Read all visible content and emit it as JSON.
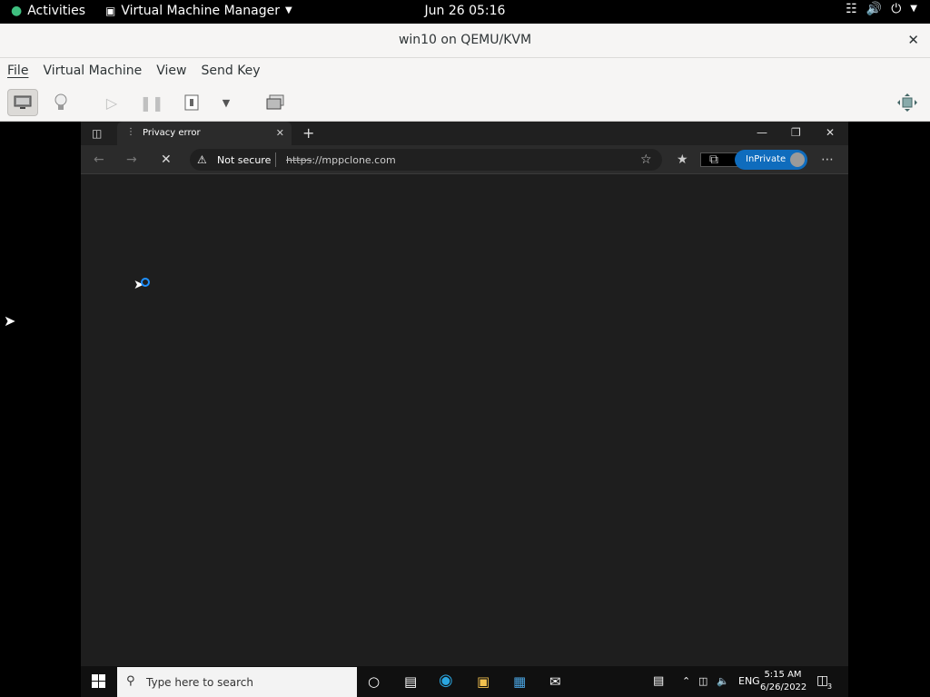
{
  "top_bar": {
    "activities_label": "Activities",
    "app_name": "Virtual Machine Manager",
    "clock": "Jun 26  05:16",
    "icons": [
      "network-icon",
      "volume-icon",
      "power-icon"
    ]
  },
  "window": {
    "title": "win10 on QEMU/KVM"
  },
  "menubar": {
    "items": [
      "File",
      "Virtual Machine",
      "View",
      "Send Key"
    ]
  },
  "toolbar": {
    "icons": [
      "console-icon",
      "details-bulb-icon",
      "run-icon",
      "pause-icon",
      "shutdown-icon",
      "dropdown-arrow-icon",
      "snapshots-icon",
      "fullscreen-icon"
    ]
  },
  "browser": {
    "tab_title": "Privacy error",
    "new_tab": "+",
    "security_label": "Not secure",
    "url_scheme": "https",
    "url_rest": "://mppclone.com",
    "inprivate_label": "InPrivate"
  },
  "taskbar": {
    "search_placeholder": "Type here to search",
    "language": "ENG",
    "time": "5:15 AM",
    "date": "6/26/2022",
    "notification_count": "3"
  }
}
